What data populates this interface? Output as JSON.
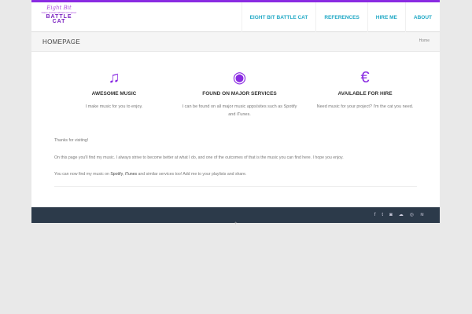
{
  "logo": {
    "line1": "Eight Bit",
    "line2": "Game and Soundtrack Composer",
    "line3": "BATTLE",
    "line4": "CAT"
  },
  "nav": [
    "EIGHT BIT BATTLE CAT",
    "REFERENCES",
    "HIRE ME",
    "ABOUT"
  ],
  "title": "HOMEPAGE",
  "breadcrumb": "Home",
  "features": [
    {
      "icon": "music-note-icon",
      "glyph": "♫",
      "title": "AWESOME MUSIC",
      "text": "I make music for you to enjoy."
    },
    {
      "icon": "spotify-icon",
      "glyph": "◉",
      "title": "FOUND ON MAJOR SERVICES",
      "text": "I can be found on all major music apps/sites such as Spotify and iTunes."
    },
    {
      "icon": "euro-icon",
      "glyph": "€",
      "title": "AVAILABLE FOR HIRE",
      "text": "Need music for your project? I'm the cat you need."
    }
  ],
  "content": {
    "p1": "Thanks for visiting!",
    "p2": "On this page you'll find my music. I always strive to become better at what I do, and one of the outcomes of that is the music you can find here. I hope you enjoy.",
    "p3a": "You can now find my music on ",
    "spotify": "Spotify",
    "comma": ", ",
    "itunes": "iTunes",
    "p3b": " and similar services too! Add me to your playlists and share."
  },
  "social": [
    "f",
    "t",
    "◙",
    "☁",
    "◎",
    "≋"
  ],
  "accent": "#8a2be2",
  "link": "#1fa8c5"
}
